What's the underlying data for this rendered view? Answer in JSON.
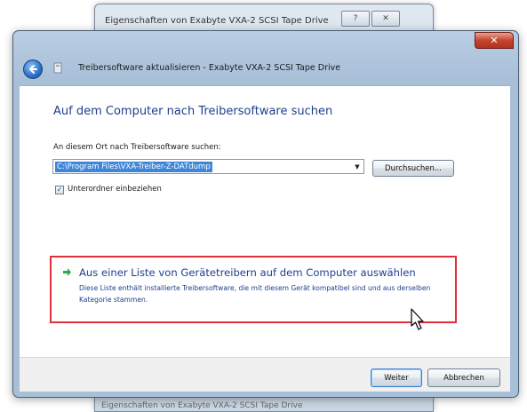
{
  "background_window": {
    "title": "Eigenschaften von Exabyte VXA-2 SCSI Tape Drive",
    "help_label": "?",
    "close_label": "✕",
    "bottom_text": "Eigenschaften von Exabyte VXA-2 SCSI Tape Drive"
  },
  "wizard": {
    "close_label": "✕",
    "title": "Treibersoftware aktualisieren - Exabyte VXA-2 SCSI Tape Drive",
    "heading": "Auf dem Computer nach Treibersoftware suchen",
    "path_label": "An diesem Ort nach Treibersoftware suchen:",
    "path_value": "C:\\Program Files\\VXA-Treiber-Z-DATdump",
    "combo_arrow": "▼",
    "browse_label": "Durchsuchen...",
    "include_subfolders": {
      "checked": true,
      "check_glyph": "✓",
      "label": "Unterordner einbeziehen"
    },
    "option": {
      "title": "Aus einer Liste von Gerätetreibern auf dem Computer auswählen",
      "description": "Diese Liste enthält installierte Treibersoftware, die mit diesem Gerät kompatibel sind und aus derselben Kategorie stammen."
    },
    "next_label": "Weiter",
    "cancel_label": "Abbrechen"
  },
  "colors": {
    "accent": "#1e3f8f",
    "highlight_border": "#e0303a",
    "selection": "#3f86d9",
    "option_arrow": "#2fa84a"
  }
}
